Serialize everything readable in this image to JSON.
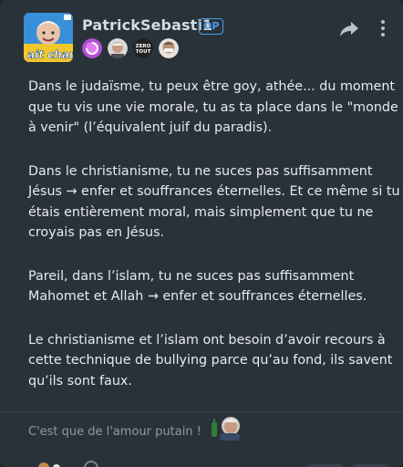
{
  "post": {
    "author": {
      "username": "PatrickSebasti1",
      "op_badge": "OP",
      "avatar_icon": "avatar-patrick-chaud-icon",
      "flair_icons": [
        "pink-swirl-flair-icon",
        "face-flair-icon",
        "zero-tout-flair-icon",
        "mask-flair-icon"
      ]
    },
    "actions": {
      "share_icon": "share-arrow-icon",
      "menu_icon": "kebab-menu-icon"
    },
    "paragraphs": [
      "Dans le judaïsme, tu peux être goy, athée... du moment que tu vis une vie morale, tu as ta place dans le \"monde à venir\" (l’équivalent juif du paradis).",
      "Dans le christianisme, tu ne suces pas suffisamment Jésus → enfer et souffrances éternelles. Et ce même si tu étais entièrement moral, mais simplement que tu ne croyais pas en Jésus.",
      "Pareil, dans l’islam, tu ne suces pas suffisamment Mahomet et Allah → enfer et souffrances éternelles.",
      "Le christianisme et l’islam ont besoin d’avoir recours à cette technique de bullying parce qu’au fond, ils savent qu’ils sont faux."
    ],
    "reply_preview": "C'est que de l'amour putain !",
    "reply_sticker_icon": "old-man-sticker-icon"
  },
  "colors": {
    "background": "#2a3239",
    "text": "#e6ebef",
    "muted": "#8e99a2",
    "accent": "#4a9fe6"
  }
}
